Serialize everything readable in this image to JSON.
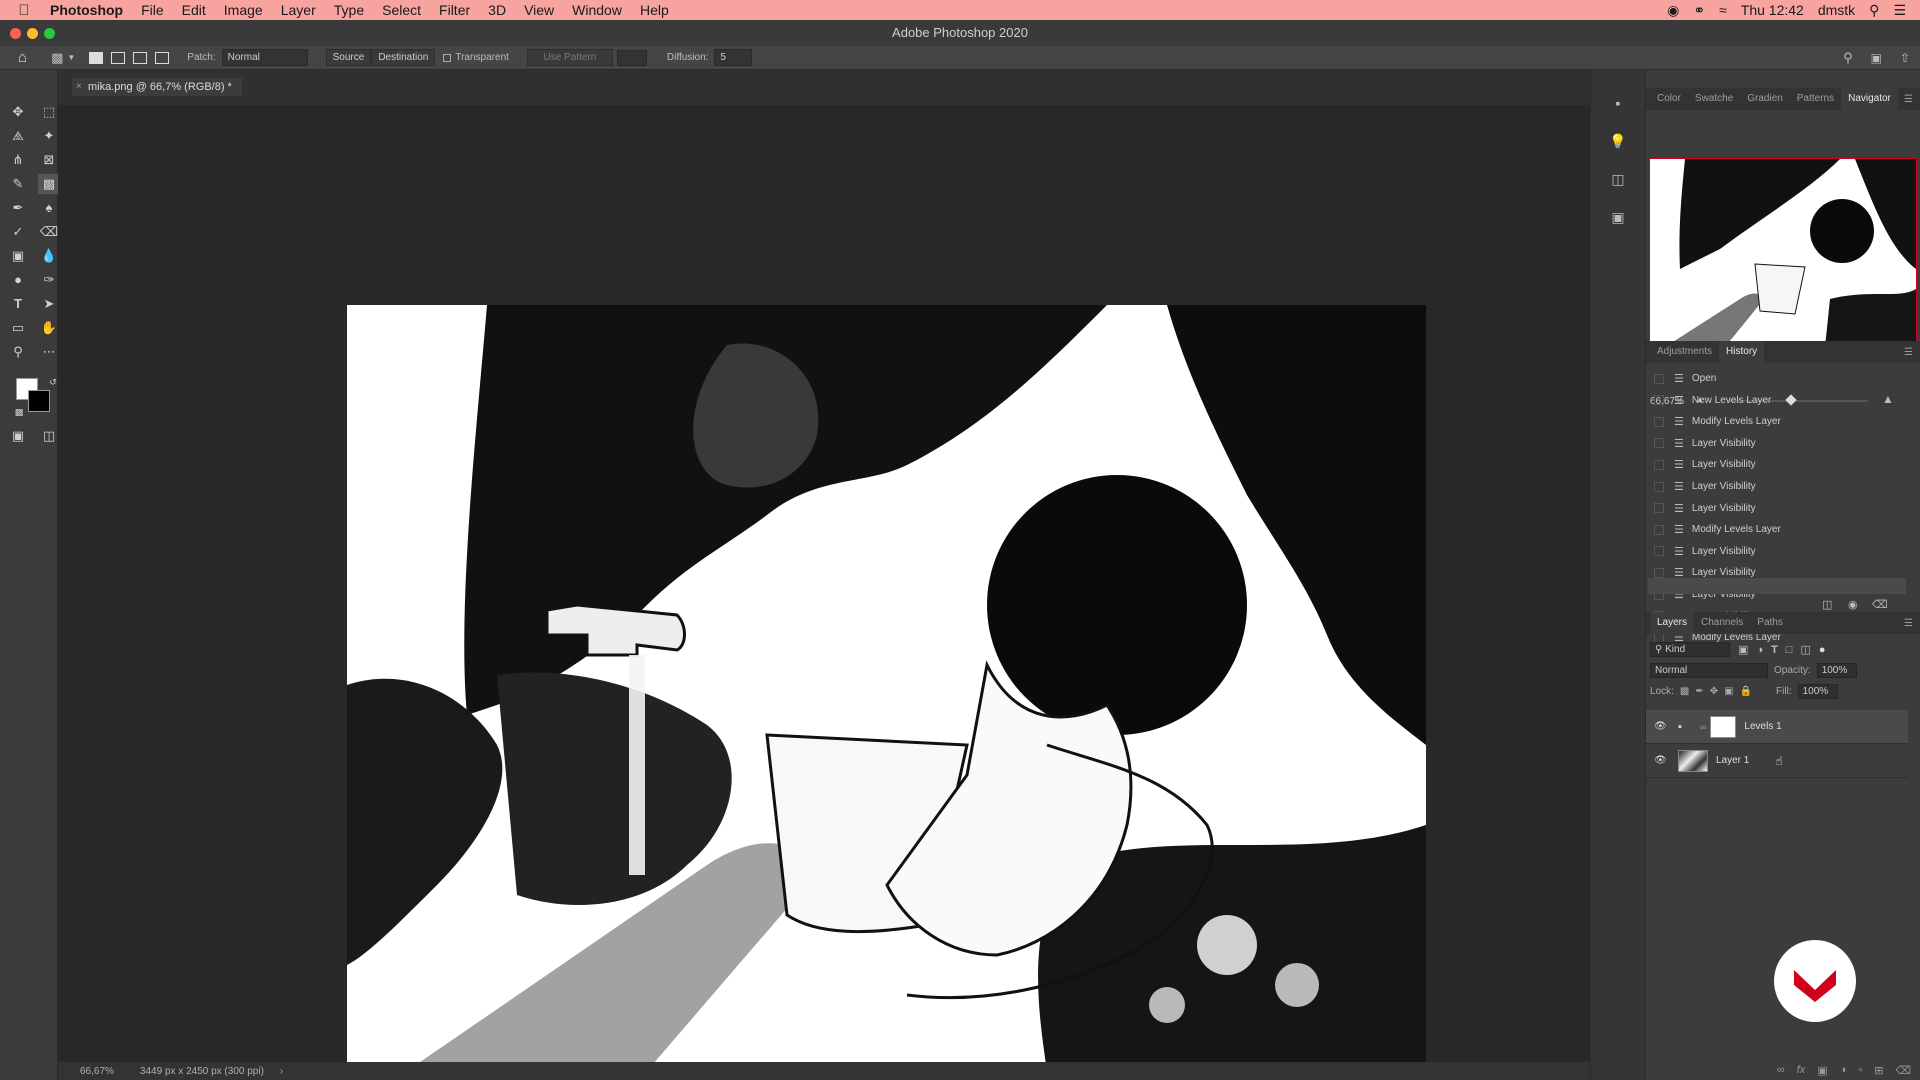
{
  "menubar": {
    "app": "Photoshop",
    "items": [
      "File",
      "Edit",
      "Image",
      "Layer",
      "Type",
      "Select",
      "Filter",
      "3D",
      "View",
      "Window",
      "Help"
    ],
    "clock": "Thu 12:42",
    "user": "dmstk"
  },
  "window": {
    "title": "Adobe Photoshop 2020"
  },
  "options": {
    "patch_label": "Patch:",
    "patch_value": "Normal",
    "source": "Source",
    "destination": "Destination",
    "transparent": "Transparent",
    "use_pattern": "Use Pattern",
    "diffusion_label": "Diffusion:",
    "diffusion_value": "5"
  },
  "document": {
    "tab_title": "mika.png @ 66,7% (RGB/8) *",
    "zoom": "66,67%",
    "info": "3449 px x 2450 px (300 ppi)"
  },
  "navigator": {
    "tabs": [
      "Color",
      "Swatche",
      "Gradien",
      "Patterns",
      "Navigator"
    ],
    "active": "Navigator",
    "zoom": "66,67%",
    "zoom_level": 0.45
  },
  "history": {
    "tabs": [
      "Adjustments",
      "History"
    ],
    "active": "History",
    "items": [
      "Open",
      "New Levels Layer",
      "Modify Levels Layer",
      "Layer Visibility",
      "Layer Visibility",
      "Layer Visibility",
      "Layer Visibility",
      "Modify Levels Layer",
      "Layer Visibility",
      "Layer Visibility",
      "Layer Visibility",
      "Layer Visibility",
      "Modify Levels Layer"
    ]
  },
  "layers": {
    "tabs": [
      "Layers",
      "Channels",
      "Paths"
    ],
    "active": "Layers",
    "filter": "Kind",
    "blend_mode": "Normal",
    "opacity_label": "Opacity:",
    "opacity": "100%",
    "lock_label": "Lock:",
    "fill_label": "Fill:",
    "fill": "100%",
    "items": [
      {
        "name": "Levels 1",
        "visible": true
      },
      {
        "name": "Layer 1",
        "visible": true
      }
    ]
  },
  "colors": {
    "menubar_bg": "#f7a3a0",
    "ui_dark": "#282828",
    "panel": "#3c3c3c",
    "accent_red": "#d0021b"
  }
}
